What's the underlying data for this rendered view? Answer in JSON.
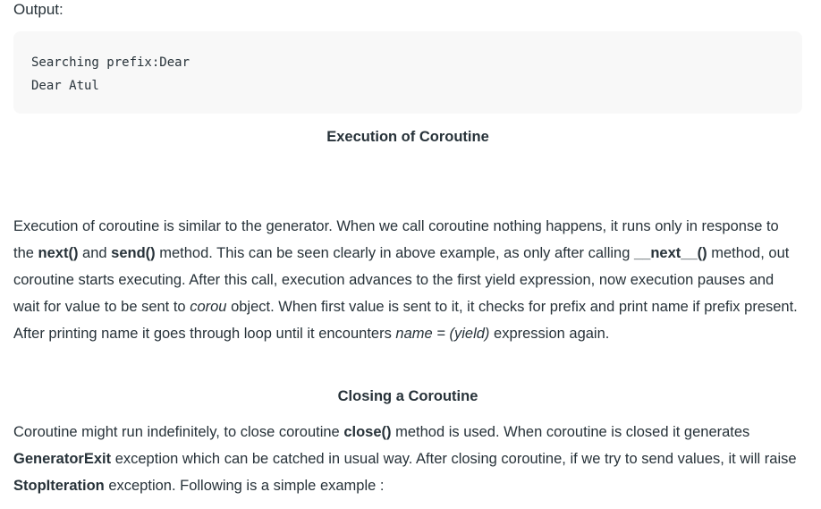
{
  "output_label": "Output:",
  "code_lines": [
    "Searching prefix:Dear",
    "Dear Atul"
  ],
  "heading_execution": "Execution of Coroutine",
  "para1": {
    "t1": "Execution of coroutine is similar to the generator. When we call coroutine nothing happens, it runs only in response to the ",
    "b1": "next()",
    "t2": " and ",
    "b2": "send()",
    "t3": " method. This can be seen clearly in above example, as only after calling ",
    "b3": "__next__()",
    "t4": " method, out coroutine starts executing. After this call, execution advances to the first yield expression, now execution pauses and wait for value to be sent to ",
    "i1": "corou",
    "t5": " object. When first value is sent to it, it checks for prefix and print name if prefix present. After printing name it goes through loop until it encounters ",
    "i2": "name = (yield)",
    "t6": " expression again."
  },
  "heading_closing": "Closing a Coroutine",
  "para2": {
    "t1": "Coroutine might run indefinitely, to close coroutine ",
    "b1": "close()",
    "t2": " method is used. When coroutine is closed it generates ",
    "b2": "GeneratorExit",
    "t3": " exception which can be catched in usual way. After closing coroutine, if we try to send values, it will raise ",
    "b3": "StopIteration",
    "t4": " exception. Following is a simple example :"
  }
}
